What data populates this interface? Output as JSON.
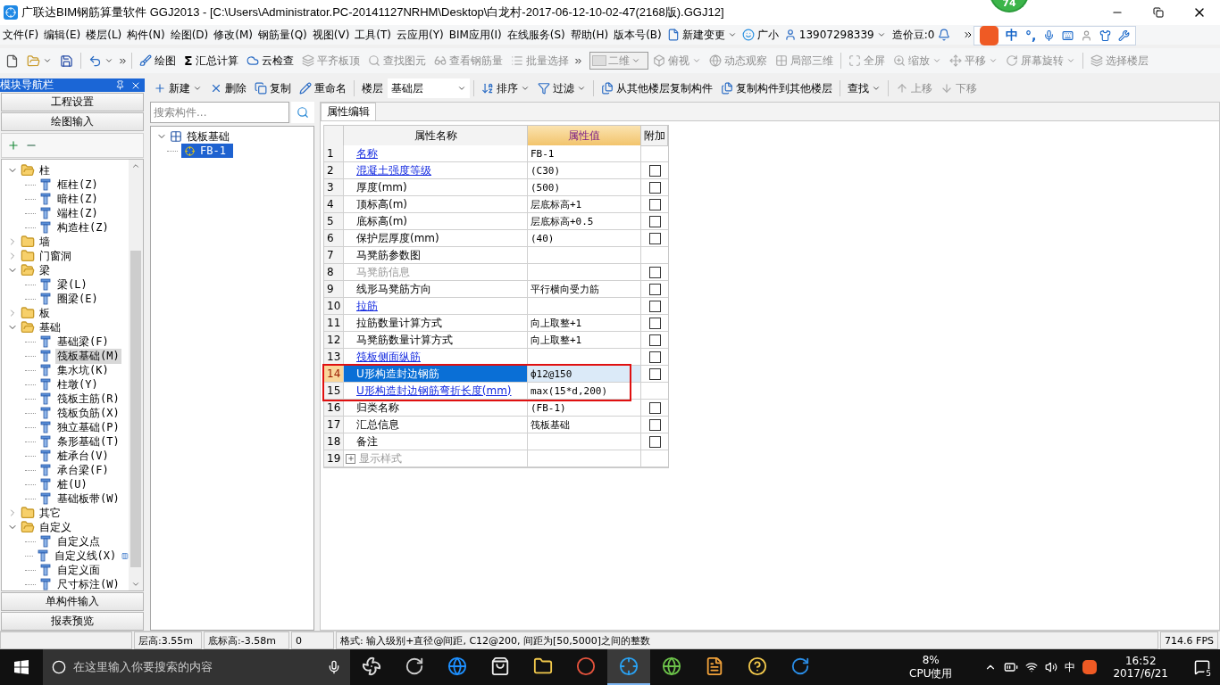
{
  "title_bar": {
    "title": "广联达BIM钢筋算量软件 GGJ2013 - [C:\\Users\\Administrator.PC-20141127NRHM\\Desktop\\白龙村-2017-06-12-10-02-47(2168版).GGJ12]",
    "badge": "74"
  },
  "menu": [
    "文件(F)",
    "编辑(E)",
    "楼层(L)",
    "构件(N)",
    "绘图(D)",
    "修改(M)",
    "钢筋量(Q)",
    "视图(V)",
    "工具(T)",
    "云应用(Y)",
    "BIM应用(I)",
    "在线服务(S)",
    "帮助(H)",
    "版本号(B)"
  ],
  "menu_extras": {
    "change": "新建变更",
    "assistant": "广小",
    "account": "13907298339",
    "beans": "造价豆:0"
  },
  "ime_bar": {
    "mode": "中",
    "punct": "°,"
  },
  "toolbar": [
    {
      "label": "绘图",
      "disabled": false
    },
    {
      "label": "汇总计算",
      "symbol": "Σ",
      "disabled": false
    },
    {
      "label": "云检查",
      "disabled": false
    },
    {
      "label": "平齐板顶",
      "disabled": true
    },
    {
      "label": "查找图元",
      "disabled": true
    },
    {
      "label": "查看钢筋量",
      "disabled": true
    },
    {
      "label": "批量选择",
      "disabled": true
    }
  ],
  "view_toolbar": {
    "view_mode": "二维",
    "items": [
      {
        "label": "俯视",
        "dropdown": true,
        "disabled": true
      },
      {
        "label": "动态观察",
        "dropdown": false,
        "disabled": true
      },
      {
        "label": "局部三维",
        "dropdown": false,
        "disabled": true
      },
      {
        "label": "全屏",
        "dropdown": false,
        "disabled": true
      },
      {
        "label": "缩放",
        "dropdown": true,
        "disabled": true
      },
      {
        "label": "平移",
        "dropdown": true,
        "disabled": true
      },
      {
        "label": "屏幕旋转",
        "dropdown": true,
        "disabled": true
      },
      {
        "label": "选择楼层",
        "dropdown": false,
        "disabled": true
      }
    ]
  },
  "nav": {
    "title": "模块导航栏",
    "top_buttons": [
      "工程设置",
      "绘图输入"
    ],
    "bottom_buttons": [
      "单构件输入",
      "报表预览"
    ],
    "tree": [
      {
        "label": "柱",
        "expanded": true,
        "children": [
          {
            "label": "框柱(Z)",
            "selected": false
          },
          {
            "label": "暗柱(Z)",
            "selected": false
          },
          {
            "label": "端柱(Z)",
            "selected": false
          },
          {
            "label": "构造柱(Z)",
            "selected": false
          }
        ]
      },
      {
        "label": "墙",
        "expanded": false
      },
      {
        "label": "门窗洞",
        "expanded": false
      },
      {
        "label": "梁",
        "expanded": true,
        "children": [
          {
            "label": "梁(L)",
            "selected": false
          },
          {
            "label": "圈梁(E)",
            "selected": false
          }
        ]
      },
      {
        "label": "板",
        "expanded": false
      },
      {
        "label": "基础",
        "expanded": true,
        "children": [
          {
            "label": "基础梁(F)",
            "selected": false
          },
          {
            "label": "筏板基础(M)",
            "selected": true
          },
          {
            "label": "集水坑(K)",
            "selected": false
          },
          {
            "label": "柱墩(Y)",
            "selected": false
          },
          {
            "label": "筏板主筋(R)",
            "selected": false
          },
          {
            "label": "筏板负筋(X)",
            "selected": false
          },
          {
            "label": "独立基础(P)",
            "selected": false
          },
          {
            "label": "条形基础(T)",
            "selected": false
          },
          {
            "label": "桩承台(V)",
            "selected": false
          },
          {
            "label": "承台梁(F)",
            "selected": false
          },
          {
            "label": "桩(U)",
            "selected": false
          },
          {
            "label": "基础板带(W)",
            "selected": false
          }
        ]
      },
      {
        "label": "其它",
        "expanded": false
      },
      {
        "label": "自定义",
        "expanded": true,
        "children": [
          {
            "label": "自定义点",
            "selected": false
          },
          {
            "label": "自定义线(X)",
            "selected": false,
            "extra_icon": true
          },
          {
            "label": "自定义面",
            "selected": false
          },
          {
            "label": "尺寸标注(W)",
            "selected": false
          }
        ]
      }
    ]
  },
  "component_toolbar": [
    {
      "kind": "button",
      "label": "新建",
      "dropdown": true,
      "disabled": false
    },
    {
      "kind": "button",
      "label": "删除",
      "dropdown": false,
      "disabled": false
    },
    {
      "kind": "button",
      "label": "复制",
      "dropdown": false,
      "disabled": false
    },
    {
      "kind": "button",
      "label": "重命名",
      "dropdown": false,
      "disabled": false
    },
    {
      "kind": "label",
      "label": "楼层"
    },
    {
      "kind": "select",
      "label": "基础层"
    },
    {
      "kind": "button",
      "label": "排序",
      "dropdown": true,
      "disabled": false
    },
    {
      "kind": "button",
      "label": "过滤",
      "dropdown": true,
      "disabled": false
    },
    {
      "kind": "button",
      "label": "从其他楼层复制构件",
      "dropdown": false,
      "disabled": false
    },
    {
      "kind": "button",
      "label": "复制构件到其他楼层",
      "dropdown": false,
      "disabled": false
    },
    {
      "kind": "button",
      "label": "查找",
      "dropdown": true,
      "disabled": false
    },
    {
      "kind": "button",
      "label": "上移",
      "dropdown": false,
      "disabled": true
    },
    {
      "kind": "button",
      "label": "下移",
      "dropdown": false,
      "disabled": true
    }
  ],
  "component_list": {
    "search_placeholder": "搜索构件...",
    "tree": [
      {
        "label": "筏板基础",
        "expanded": true,
        "children": [
          {
            "label": "FB-1",
            "selected": true
          }
        ]
      }
    ]
  },
  "properties": {
    "tabs": [
      {
        "label": "属性编辑",
        "selected": true
      }
    ],
    "columns": [
      "属性名称",
      "属性值",
      "附加"
    ],
    "rows": [
      {
        "num": "1",
        "name": "名称",
        "value": "FB-1",
        "link": true,
        "disabled": false,
        "selected": false,
        "outlined": false
      },
      {
        "num": "2",
        "name": "混凝土强度等级",
        "value": "(C30)",
        "link": true,
        "disabled": false,
        "selected": false,
        "outlined": false,
        "addon": {
          "checked": false
        }
      },
      {
        "num": "3",
        "name": "厚度(mm)",
        "value": "(500)",
        "link": false,
        "disabled": false,
        "selected": false,
        "outlined": false,
        "addon": {
          "checked": false
        }
      },
      {
        "num": "4",
        "name": "顶标高(m)",
        "value": "层底标高+1",
        "link": false,
        "disabled": false,
        "selected": false,
        "outlined": false,
        "addon": {
          "checked": false
        }
      },
      {
        "num": "5",
        "name": "底标高(m)",
        "value": "层底标高+0.5",
        "link": false,
        "disabled": false,
        "selected": false,
        "outlined": false,
        "addon": {
          "checked": false
        }
      },
      {
        "num": "6",
        "name": "保护层厚度(mm)",
        "value": "(40)",
        "link": false,
        "disabled": false,
        "selected": false,
        "outlined": false,
        "addon": {
          "checked": false
        }
      },
      {
        "num": "7",
        "name": "马凳筋参数图",
        "link": false,
        "disabled": false,
        "selected": false,
        "outlined": false
      },
      {
        "num": "8",
        "name": "马凳筋信息",
        "link": false,
        "disabled": true,
        "selected": false,
        "outlined": false,
        "addon": {
          "checked": false
        }
      },
      {
        "num": "9",
        "name": "线形马凳筋方向",
        "value": "平行横向受力筋",
        "link": false,
        "disabled": false,
        "selected": false,
        "outlined": false,
        "addon": {
          "checked": false
        }
      },
      {
        "num": "10",
        "name": "拉筋",
        "link": true,
        "disabled": false,
        "selected": false,
        "outlined": false,
        "addon": {
          "checked": false
        }
      },
      {
        "num": "11",
        "name": "拉筋数量计算方式",
        "value": "向上取整+1",
        "link": false,
        "disabled": false,
        "selected": false,
        "outlined": false,
        "addon": {
          "checked": false
        }
      },
      {
        "num": "12",
        "name": "马凳筋数量计算方式",
        "value": "向上取整+1",
        "link": false,
        "disabled": false,
        "selected": false,
        "outlined": false,
        "addon": {
          "checked": false
        }
      },
      {
        "num": "13",
        "name": "筏板侧面纵筋",
        "link": true,
        "disabled": false,
        "selected": false,
        "outlined": false,
        "addon": {
          "checked": false
        }
      },
      {
        "num": "14",
        "name": "U形构造封边钢筋",
        "value": "ф12@150",
        "link": true,
        "disabled": false,
        "selected": true,
        "outlined": true,
        "addon": {
          "checked": false
        }
      },
      {
        "num": "15",
        "name": "U形构造封边钢筋弯折长度(mm)",
        "value": "max(15*d,200)",
        "link": true,
        "disabled": false,
        "selected": false,
        "outlined": true
      },
      {
        "num": "16",
        "name": "归类名称",
        "value": "(FB-1)",
        "link": false,
        "disabled": false,
        "selected": false,
        "outlined": false,
        "addon": {
          "checked": false
        }
      },
      {
        "num": "17",
        "name": "汇总信息",
        "value": "筏板基础",
        "link": false,
        "disabled": false,
        "selected": false,
        "outlined": false,
        "addon": {
          "checked": false
        }
      },
      {
        "num": "18",
        "name": "备注",
        "link": false,
        "disabled": false,
        "selected": false,
        "outlined": false,
        "addon": {
          "checked": false
        }
      },
      {
        "num": "19",
        "name": "显示样式",
        "kind": "group",
        "expanded": false,
        "link": false,
        "disabled": true,
        "selected": false,
        "outlined": false
      }
    ]
  },
  "status_bar": [
    "层高:3.55m",
    "底标高:-3.58m",
    "0",
    "格式: 输入级别+直径@间距, C12@200, 间距为[50,5000]之间的整数",
    "714.6 FPS"
  ],
  "taskbar": {
    "search_placeholder": "在这里输入你要搜索的内容",
    "apps": [
      {
        "active": false
      },
      {
        "active": false
      },
      {
        "active": false
      },
      {
        "active": false
      },
      {
        "active": false
      },
      {
        "active": false
      },
      {
        "active": true
      },
      {
        "active": false
      },
      {
        "active": false
      },
      {
        "active": false
      },
      {
        "active": false
      }
    ],
    "cpu": "8%",
    "cpu_label": "CPU使用",
    "ime": "中",
    "time": "16:52",
    "date": "2017/6/21",
    "notifications": "5"
  }
}
